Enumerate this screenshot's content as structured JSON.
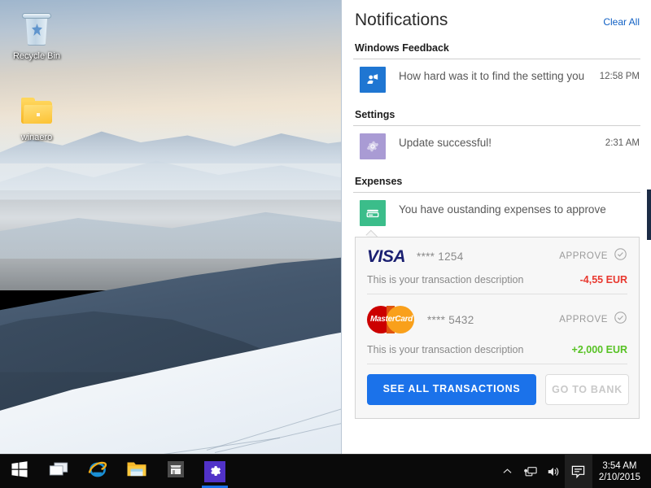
{
  "desktop": {
    "icons": [
      {
        "label": "Recycle Bin",
        "icon": "recycle-bin-icon"
      },
      {
        "label": "winaero",
        "icon": "folder-icon"
      }
    ]
  },
  "panel": {
    "title": "Notifications",
    "clear_all": "Clear All",
    "groups": [
      {
        "title": "Windows Feedback",
        "items": [
          {
            "text": "How hard was it to find the setting you",
            "time": "12:58 PM",
            "icon": "feedback-icon",
            "icon_color": "#1f76d2"
          }
        ]
      },
      {
        "title": "Settings",
        "items": [
          {
            "text": "Update successful!",
            "time": "2:31 AM",
            "icon": "gear-icon",
            "icon_color": "#a99bd4"
          }
        ]
      },
      {
        "title": "Expenses",
        "items": [
          {
            "text": "You have oustanding expenses to approve",
            "time": "",
            "icon": "credit-card-icon",
            "icon_color": "#3bbd8a"
          }
        ]
      }
    ],
    "expense_card": {
      "transactions": [
        {
          "brand": "VISA",
          "brand_icon": "visa-logo",
          "mask": "**** 1254",
          "approve_label": "APPROVE",
          "approve_icon": "check-circle-icon",
          "description": "This is your transaction description",
          "amount": "-4,55 EUR",
          "amount_sign": "negative",
          "amount_color": "#e8382f"
        },
        {
          "brand": "MasterCard",
          "brand_icon": "mastercard-logo",
          "mask": "**** 5432",
          "approve_label": "APPROVE",
          "approve_icon": "check-circle-icon",
          "description": "This is your transaction description",
          "amount": "+2,000 EUR",
          "amount_sign": "positive",
          "amount_color": "#57c224"
        }
      ],
      "primary_button": "SEE ALL TRANSACTIONS",
      "secondary_button": "GO TO BANK",
      "primary_color": "#1b72ea"
    }
  },
  "taskbar": {
    "buttons": [
      {
        "name": "start-button",
        "icon": "windows-logo-icon",
        "active": false
      },
      {
        "name": "task-view-button",
        "icon": "task-view-icon",
        "active": false
      },
      {
        "name": "internet-explorer-button",
        "icon": "internet-explorer-icon",
        "active": false
      },
      {
        "name": "file-explorer-button",
        "icon": "file-explorer-icon",
        "active": false
      },
      {
        "name": "store-button",
        "icon": "store-icon",
        "active": false
      },
      {
        "name": "settings-button",
        "icon": "gear-icon",
        "active": true
      }
    ],
    "tray": {
      "show_hidden_icon": "chevron-up-icon",
      "network_icon": "network-icon",
      "volume_icon": "speaker-icon",
      "action_center_icon": "action-center-icon"
    },
    "clock": {
      "time": "3:54 AM",
      "date": "2/10/2015"
    }
  }
}
